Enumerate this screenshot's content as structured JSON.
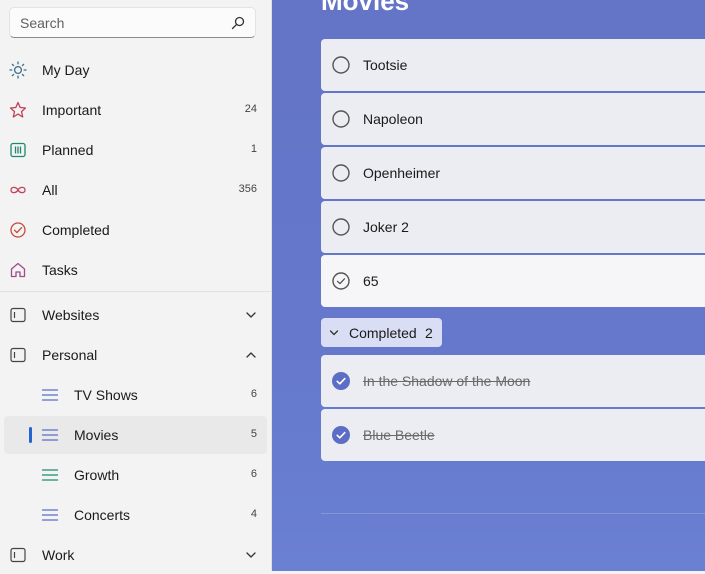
{
  "search": {
    "placeholder": "Search"
  },
  "sidebar": {
    "smart_lists": [
      {
        "label": "My Day",
        "count": ""
      },
      {
        "label": "Important",
        "count": "24"
      },
      {
        "label": "Planned",
        "count": "1"
      },
      {
        "label": "All",
        "count": "356"
      },
      {
        "label": "Completed",
        "count": ""
      },
      {
        "label": "Tasks",
        "count": ""
      }
    ],
    "groups": {
      "websites": {
        "label": "Websites"
      },
      "personal": {
        "label": "Personal"
      },
      "work": {
        "label": "Work"
      }
    },
    "personal_lists": [
      {
        "label": "TV Shows",
        "count": "6"
      },
      {
        "label": "Movies",
        "count": "5"
      },
      {
        "label": "Growth",
        "count": "6"
      },
      {
        "label": "Concerts",
        "count": "4"
      }
    ]
  },
  "main": {
    "title": "Movies",
    "tasks": [
      {
        "title": "Tootsie"
      },
      {
        "title": "Napoleon"
      },
      {
        "title": "Openheimer"
      },
      {
        "title": "Joker 2"
      },
      {
        "title": "65"
      }
    ],
    "completed_section": {
      "label": "Completed",
      "count": "2"
    },
    "completed_tasks": [
      {
        "title": "In the Shadow of the Moon"
      },
      {
        "title": "Blue Beetle"
      }
    ]
  },
  "colors": {
    "accent": "#2564cf",
    "main_background": "#6474c6",
    "checked": "#5b6dc4",
    "important_icon": "#c2405a",
    "planned_icon": "#1a8a6e",
    "completed_icon": "#c44a3a",
    "tasks_icon": "#a04a90"
  },
  "icons": {
    "search": "search-icon",
    "my_day": "sun-icon",
    "important": "star-icon",
    "planned": "calendar-icon",
    "all": "infinity-icon",
    "completed": "check-circle-icon",
    "tasks": "home-icon",
    "group": "group-icon",
    "list": "list-icon"
  }
}
